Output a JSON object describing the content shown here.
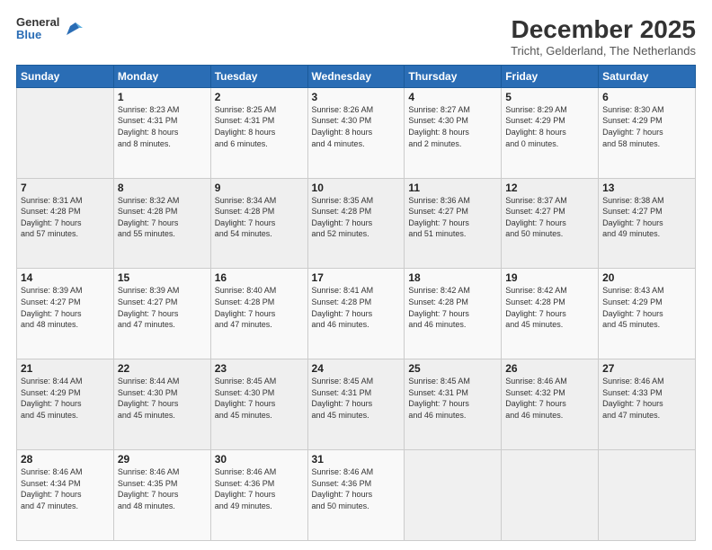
{
  "logo": {
    "general": "General",
    "blue": "Blue"
  },
  "header": {
    "month": "December 2025",
    "location": "Tricht, Gelderland, The Netherlands"
  },
  "days_of_week": [
    "Sunday",
    "Monday",
    "Tuesday",
    "Wednesday",
    "Thursday",
    "Friday",
    "Saturday"
  ],
  "weeks": [
    [
      {
        "day": "",
        "info": ""
      },
      {
        "day": "1",
        "info": "Sunrise: 8:23 AM\nSunset: 4:31 PM\nDaylight: 8 hours\nand 8 minutes."
      },
      {
        "day": "2",
        "info": "Sunrise: 8:25 AM\nSunset: 4:31 PM\nDaylight: 8 hours\nand 6 minutes."
      },
      {
        "day": "3",
        "info": "Sunrise: 8:26 AM\nSunset: 4:30 PM\nDaylight: 8 hours\nand 4 minutes."
      },
      {
        "day": "4",
        "info": "Sunrise: 8:27 AM\nSunset: 4:30 PM\nDaylight: 8 hours\nand 2 minutes."
      },
      {
        "day": "5",
        "info": "Sunrise: 8:29 AM\nSunset: 4:29 PM\nDaylight: 8 hours\nand 0 minutes."
      },
      {
        "day": "6",
        "info": "Sunrise: 8:30 AM\nSunset: 4:29 PM\nDaylight: 7 hours\nand 58 minutes."
      }
    ],
    [
      {
        "day": "7",
        "info": "Sunrise: 8:31 AM\nSunset: 4:28 PM\nDaylight: 7 hours\nand 57 minutes."
      },
      {
        "day": "8",
        "info": "Sunrise: 8:32 AM\nSunset: 4:28 PM\nDaylight: 7 hours\nand 55 minutes."
      },
      {
        "day": "9",
        "info": "Sunrise: 8:34 AM\nSunset: 4:28 PM\nDaylight: 7 hours\nand 54 minutes."
      },
      {
        "day": "10",
        "info": "Sunrise: 8:35 AM\nSunset: 4:28 PM\nDaylight: 7 hours\nand 52 minutes."
      },
      {
        "day": "11",
        "info": "Sunrise: 8:36 AM\nSunset: 4:27 PM\nDaylight: 7 hours\nand 51 minutes."
      },
      {
        "day": "12",
        "info": "Sunrise: 8:37 AM\nSunset: 4:27 PM\nDaylight: 7 hours\nand 50 minutes."
      },
      {
        "day": "13",
        "info": "Sunrise: 8:38 AM\nSunset: 4:27 PM\nDaylight: 7 hours\nand 49 minutes."
      }
    ],
    [
      {
        "day": "14",
        "info": "Sunrise: 8:39 AM\nSunset: 4:27 PM\nDaylight: 7 hours\nand 48 minutes."
      },
      {
        "day": "15",
        "info": "Sunrise: 8:39 AM\nSunset: 4:27 PM\nDaylight: 7 hours\nand 47 minutes."
      },
      {
        "day": "16",
        "info": "Sunrise: 8:40 AM\nSunset: 4:28 PM\nDaylight: 7 hours\nand 47 minutes."
      },
      {
        "day": "17",
        "info": "Sunrise: 8:41 AM\nSunset: 4:28 PM\nDaylight: 7 hours\nand 46 minutes."
      },
      {
        "day": "18",
        "info": "Sunrise: 8:42 AM\nSunset: 4:28 PM\nDaylight: 7 hours\nand 46 minutes."
      },
      {
        "day": "19",
        "info": "Sunrise: 8:42 AM\nSunset: 4:28 PM\nDaylight: 7 hours\nand 45 minutes."
      },
      {
        "day": "20",
        "info": "Sunrise: 8:43 AM\nSunset: 4:29 PM\nDaylight: 7 hours\nand 45 minutes."
      }
    ],
    [
      {
        "day": "21",
        "info": "Sunrise: 8:44 AM\nSunset: 4:29 PM\nDaylight: 7 hours\nand 45 minutes."
      },
      {
        "day": "22",
        "info": "Sunrise: 8:44 AM\nSunset: 4:30 PM\nDaylight: 7 hours\nand 45 minutes."
      },
      {
        "day": "23",
        "info": "Sunrise: 8:45 AM\nSunset: 4:30 PM\nDaylight: 7 hours\nand 45 minutes."
      },
      {
        "day": "24",
        "info": "Sunrise: 8:45 AM\nSunset: 4:31 PM\nDaylight: 7 hours\nand 45 minutes."
      },
      {
        "day": "25",
        "info": "Sunrise: 8:45 AM\nSunset: 4:31 PM\nDaylight: 7 hours\nand 46 minutes."
      },
      {
        "day": "26",
        "info": "Sunrise: 8:46 AM\nSunset: 4:32 PM\nDaylight: 7 hours\nand 46 minutes."
      },
      {
        "day": "27",
        "info": "Sunrise: 8:46 AM\nSunset: 4:33 PM\nDaylight: 7 hours\nand 47 minutes."
      }
    ],
    [
      {
        "day": "28",
        "info": "Sunrise: 8:46 AM\nSunset: 4:34 PM\nDaylight: 7 hours\nand 47 minutes."
      },
      {
        "day": "29",
        "info": "Sunrise: 8:46 AM\nSunset: 4:35 PM\nDaylight: 7 hours\nand 48 minutes."
      },
      {
        "day": "30",
        "info": "Sunrise: 8:46 AM\nSunset: 4:36 PM\nDaylight: 7 hours\nand 49 minutes."
      },
      {
        "day": "31",
        "info": "Sunrise: 8:46 AM\nSunset: 4:36 PM\nDaylight: 7 hours\nand 50 minutes."
      },
      {
        "day": "",
        "info": ""
      },
      {
        "day": "",
        "info": ""
      },
      {
        "day": "",
        "info": ""
      }
    ]
  ]
}
